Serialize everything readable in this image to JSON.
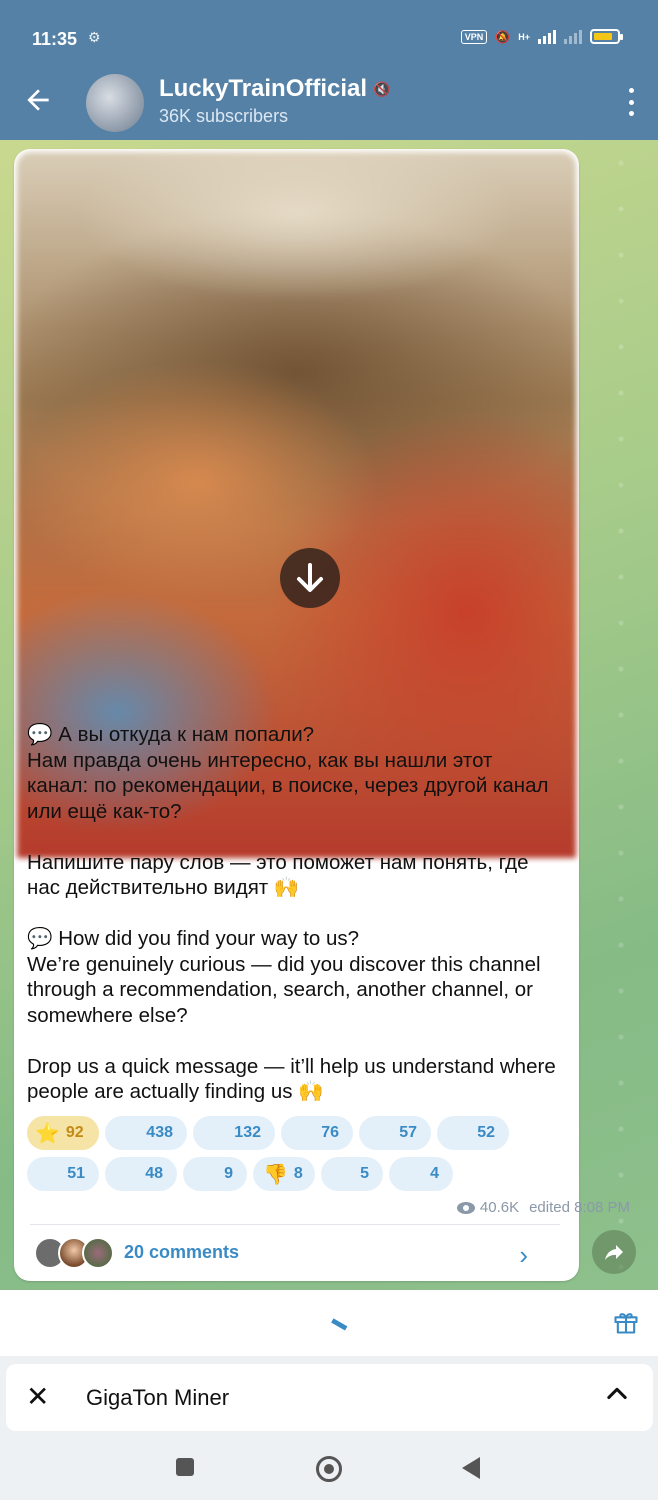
{
  "status_bar": {
    "time": "11:35",
    "vpn": "VPN",
    "network": "H+"
  },
  "header": {
    "title": "LuckyTrainOfficial",
    "subtitle": "36K subscribers"
  },
  "post": {
    "text": "💬 А вы откуда к нам попали?\nНам правда очень интересно, как вы нашли этот канал: по рекомендации, в поиске, через другой канал или ещё как-то?\n\nНапишите пару слов — это поможет нам понять, где нас действительно видят 🙌\n\n💬 How did you find your way to us?\nWe’re genuinely curious — did you discover this channel through a recommendation, search, another channel, or somewhere else?\n\nDrop us a quick message — it’ll help us understand where people are actually finding us 🙌",
    "views": "40.6K",
    "edited": "edited 8:08 PM",
    "comments_label": "20 comments"
  },
  "reactions": [
    {
      "emoji": "⭐",
      "count": "92",
      "active": true
    },
    {
      "emoji": "",
      "count": "438"
    },
    {
      "emoji": "",
      "count": "132"
    },
    {
      "emoji": "",
      "count": "76"
    },
    {
      "emoji": "",
      "count": "57"
    },
    {
      "emoji": "",
      "count": "52"
    },
    {
      "emoji": "",
      "count": "51"
    },
    {
      "emoji": "",
      "count": "48"
    },
    {
      "emoji": "",
      "count": "9"
    },
    {
      "emoji": "👎",
      "count": "8"
    },
    {
      "emoji": "",
      "count": "5"
    },
    {
      "emoji": "",
      "count": "4"
    }
  ],
  "bot_panel": {
    "name": "GigaTon Miner"
  },
  "colors": {
    "header": "#5581a6",
    "accent": "#3a8bc5",
    "star_reaction": "#f6e4a6"
  },
  "icons": [
    "back-arrow-icon",
    "mute-icon",
    "more-vert-icon",
    "download-icon",
    "eye-icon",
    "chevron-right-icon",
    "share-icon",
    "gift-icon",
    "close-icon",
    "chevron-up-icon"
  ]
}
